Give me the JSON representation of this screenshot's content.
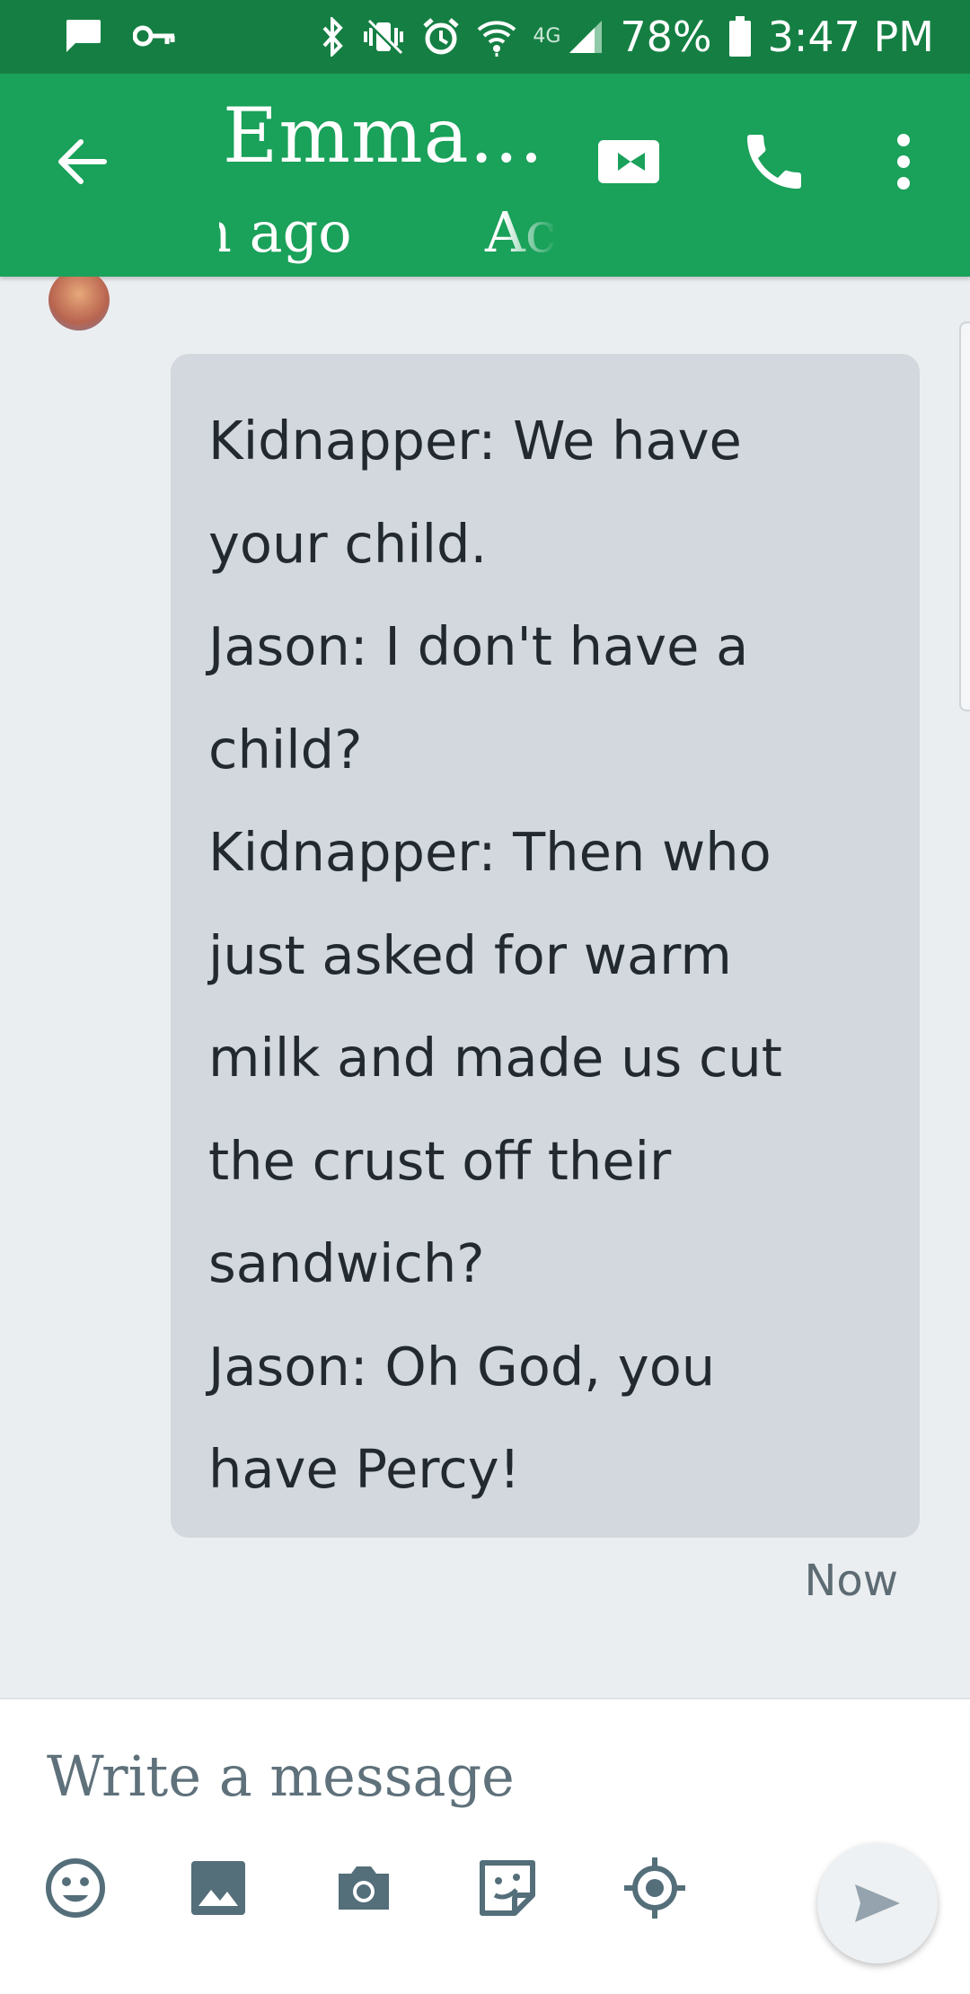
{
  "status_bar": {
    "battery": "78%",
    "time": "3:47 PM",
    "network": "4G",
    "icons": [
      "message-icon",
      "key-icon",
      "bluetooth-icon",
      "vibrate-icon",
      "alarm-icon",
      "wifi-icon",
      "signal-icon",
      "battery-icon"
    ]
  },
  "app_bar": {
    "contact_name": "Emma...",
    "subtitle_fragment_1": "h ago",
    "subtitle_fragment_2": "Ac",
    "icons": [
      "back-arrow-icon",
      "video-call-icon",
      "phone-icon",
      "more-vert-icon"
    ]
  },
  "conversation": {
    "message": {
      "text": "Kidnapper: We have\nyour child.\nJason: I don't have a\nchild?\nKidnapper: Then who\njust asked for warm\nmilk and made us cut\nthe crust off their\nsandwich?\nJason: Oh God, you\nhave Percy!",
      "timestamp": "Now"
    }
  },
  "composer": {
    "placeholder": "Write a message",
    "value": "",
    "tools": [
      "emoji-icon",
      "image-icon",
      "camera-icon",
      "sticker-icon",
      "location-icon",
      "send-icon"
    ]
  },
  "colors": {
    "status_bar": "#157f43",
    "app_bar": "#1aa15a",
    "background": "#ebeef0",
    "bubble": "#d2d8dd",
    "icon_slate": "#546e7a"
  }
}
